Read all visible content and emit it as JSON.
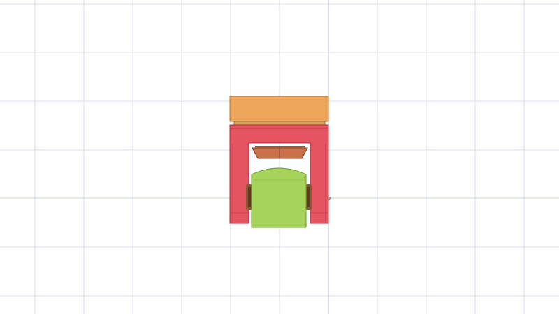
{
  "viewport": {
    "background": "#ffffff",
    "grid_color": "#dcdcec",
    "axis_x_color": "#bfe6bf",
    "axis_y_color": "#b9b9ea"
  },
  "model": {
    "parts": [
      {
        "name": "top-plate",
        "color": "#eea65c"
      },
      {
        "name": "frame",
        "color": "#e55561"
      },
      {
        "name": "bearing-disc",
        "color": "#c9714a"
      },
      {
        "name": "roller",
        "color": "#a6d45a"
      },
      {
        "name": "axle-hub",
        "color": "#8a5a34"
      }
    ]
  }
}
